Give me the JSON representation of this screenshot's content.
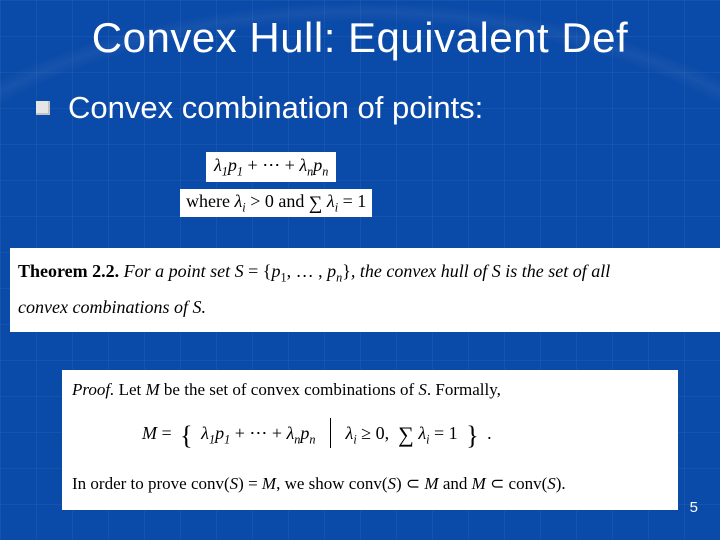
{
  "title": "Convex Hull: Equivalent Def",
  "bullet": "Convex combination of points:",
  "eq_combo": "λ₁p₁ + ⋯ + λₙpₙ",
  "eq_where": "where λᵢ > 0 and ∑ λᵢ = 1",
  "theorem_label": "Theorem 2.2.",
  "theorem_body_1": "For a point set S = {p₁, … , pₙ}, the convex hull of S is the set of all",
  "theorem_body_2": "convex combinations of S.",
  "proof_label": "Proof.",
  "proof_line1": "Let M be the set of convex combinations of S. Formally,",
  "proof_eq": "M = { λ₁p₁ + ⋯ + λₙpₙ  |  λᵢ ≥ 0,  ∑ λᵢ = 1 } .",
  "proof_line2": "In order to prove conv(S) = M, we show conv(S) ⊂ M and M ⊂ conv(S).",
  "page_number": "5"
}
